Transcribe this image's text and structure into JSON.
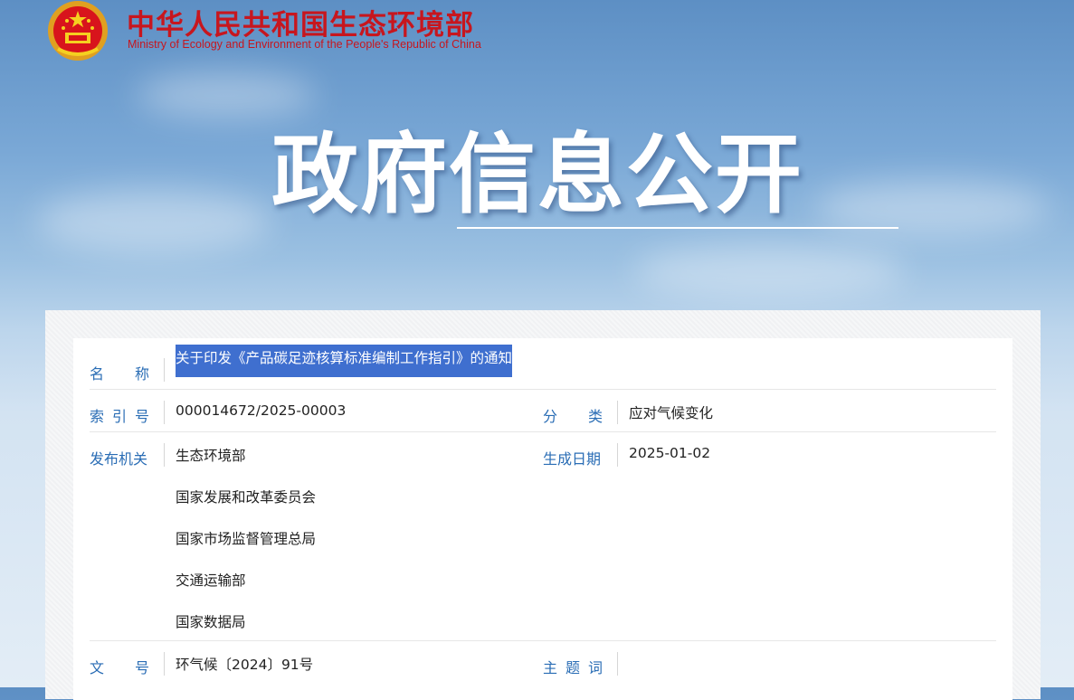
{
  "header": {
    "ministry_cn": "中华人民共和国生态环境部",
    "ministry_en": "Ministry of Ecology and Environment of the People's Republic of China"
  },
  "hero": {
    "title": "政府信息公开"
  },
  "colors": {
    "ministry_red": "#c7161e",
    "label_blue": "#2a6db5",
    "selection": "#3f6fcf"
  },
  "fields": {
    "name": {
      "label": "名称",
      "value": "关于印发《产品碳足迹核算标准编制工作指引》的通知"
    },
    "index_no": {
      "label": "索引号",
      "value": "000014672/2025-00003"
    },
    "category": {
      "label": "分类",
      "value": "应对气候变化"
    },
    "publisher": {
      "label": "发布机关",
      "values": [
        "生态环境部",
        "国家发展和改革委员会",
        "国家市场监督管理总局",
        "交通运输部",
        "国家数据局"
      ]
    },
    "date": {
      "label": "生成日期",
      "value": "2025-01-02"
    },
    "doc_no": {
      "label": "文号",
      "value": "环气候〔2024〕91号"
    },
    "keywords": {
      "label": "主题词",
      "value": ""
    }
  }
}
